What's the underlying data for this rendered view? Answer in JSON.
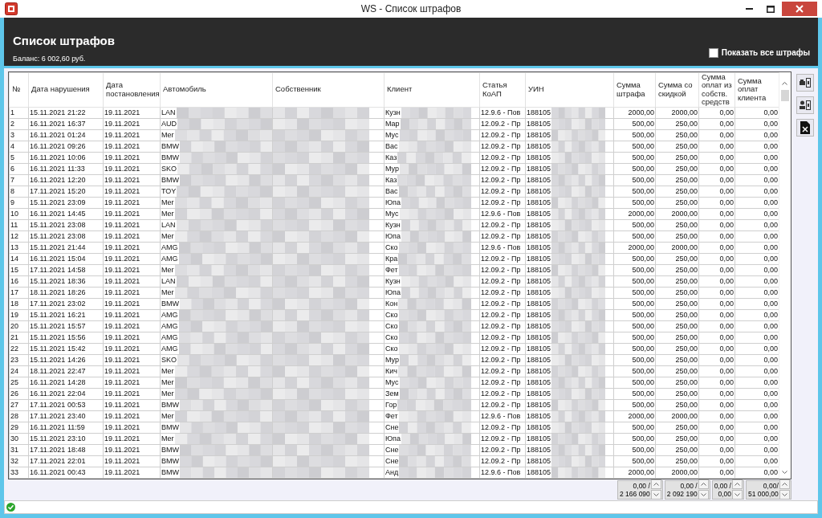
{
  "window": {
    "title": "WS - Список штрафов"
  },
  "header": {
    "title": "Список штрафов",
    "balance": "Баланс: 6 002,60 руб.",
    "show_all": {
      "label": "Показать все штрафы",
      "checked": false
    }
  },
  "table": {
    "columns": [
      "№",
      "Дата нарушения",
      "Дата постановления",
      "Автомобиль",
      "Собственник",
      "Клиент",
      "Статья КоАП",
      "УИН",
      "Сумма штрафа",
      "Сумма со скидкой",
      "Сумма оплат из собств. средств",
      "Сумма оплат клиента"
    ],
    "rows": [
      {
        "no": "1",
        "violation_date": "15.11.2021 21:22",
        "ruling_date": "19.11.2021",
        "car": "LAN",
        "client": "Кузн",
        "article": "12.9.6 - Пов",
        "uin": "188105",
        "fine": "2000,00",
        "discounted": "2000,00",
        "own_paid": "0,00",
        "client_paid": "0,00"
      },
      {
        "no": "2",
        "violation_date": "16.11.2021 16:37",
        "ruling_date": "19.11.2021",
        "car": "AUD",
        "client": "Мар",
        "article": "12.09.2 - Пр",
        "uin": "188105",
        "fine": "500,00",
        "discounted": "250,00",
        "own_paid": "0,00",
        "client_paid": "0,00"
      },
      {
        "no": "3",
        "violation_date": "16.11.2021 01:24",
        "ruling_date": "19.11.2021",
        "car": "Mer",
        "client": "Мус",
        "article": "12.09.2 - Пр",
        "uin": "188105",
        "fine": "500,00",
        "discounted": "250,00",
        "own_paid": "0,00",
        "client_paid": "0,00"
      },
      {
        "no": "4",
        "violation_date": "16.11.2021 09:26",
        "ruling_date": "19.11.2021",
        "car": "BMW",
        "client": "Вас",
        "article": "12.09.2 - Пр",
        "uin": "188105",
        "fine": "500,00",
        "discounted": "250,00",
        "own_paid": "0,00",
        "client_paid": "0,00"
      },
      {
        "no": "5",
        "violation_date": "16.11.2021 10:06",
        "ruling_date": "19.11.2021",
        "car": "BMW",
        "client": "Каз",
        "article": "12.09.2 - Пр",
        "uin": "188105",
        "fine": "500,00",
        "discounted": "250,00",
        "own_paid": "0,00",
        "client_paid": "0,00"
      },
      {
        "no": "6",
        "violation_date": "16.11.2021 11:33",
        "ruling_date": "19.11.2021",
        "car": "SKO",
        "client": "Мур",
        "article": "12.09.2 - Пр",
        "uin": "188105",
        "fine": "500,00",
        "discounted": "250,00",
        "own_paid": "0,00",
        "client_paid": "0,00"
      },
      {
        "no": "7",
        "violation_date": "16.11.2021 12:20",
        "ruling_date": "19.11.2021",
        "car": "BMW",
        "client": "Каз",
        "article": "12.09.2 - Пр",
        "uin": "188105",
        "fine": "500,00",
        "discounted": "250,00",
        "own_paid": "0,00",
        "client_paid": "0,00"
      },
      {
        "no": "8",
        "violation_date": "17.11.2021 15:20",
        "ruling_date": "19.11.2021",
        "car": "TOY",
        "client": "Вас",
        "article": "12.09.2 - Пр",
        "uin": "188105",
        "fine": "500,00",
        "discounted": "250,00",
        "own_paid": "0,00",
        "client_paid": "0,00"
      },
      {
        "no": "9",
        "violation_date": "15.11.2021 23:09",
        "ruling_date": "19.11.2021",
        "car": "Mer",
        "client": "Юпа",
        "article": "12.09.2 - Пр",
        "uin": "188105",
        "fine": "500,00",
        "discounted": "250,00",
        "own_paid": "0,00",
        "client_paid": "0,00"
      },
      {
        "no": "10",
        "violation_date": "16.11.2021 14:45",
        "ruling_date": "19.11.2021",
        "car": "Mer",
        "client": "Мус",
        "article": "12.9.6 - Пов",
        "uin": "188105",
        "fine": "2000,00",
        "discounted": "2000,00",
        "own_paid": "0,00",
        "client_paid": "0,00"
      },
      {
        "no": "11",
        "violation_date": "15.11.2021 23:08",
        "ruling_date": "19.11.2021",
        "car": "LAN",
        "client": "Кузн",
        "article": "12.09.2 - Пр",
        "uin": "188105",
        "fine": "500,00",
        "discounted": "250,00",
        "own_paid": "0,00",
        "client_paid": "0,00"
      },
      {
        "no": "12",
        "violation_date": "15.11.2021 23:08",
        "ruling_date": "19.11.2021",
        "car": "Mer",
        "client": "Юпа",
        "article": "12.09.2 - Пр",
        "uin": "188105",
        "fine": "500,00",
        "discounted": "250,00",
        "own_paid": "0,00",
        "client_paid": "0,00"
      },
      {
        "no": "13",
        "violation_date": "15.11.2021 21:44",
        "ruling_date": "19.11.2021",
        "car": "AMG",
        "client": "Ско",
        "article": "12.9.6 - Пов",
        "uin": "188105",
        "fine": "2000,00",
        "discounted": "2000,00",
        "own_paid": "0,00",
        "client_paid": "0,00"
      },
      {
        "no": "14",
        "violation_date": "16.11.2021 15:04",
        "ruling_date": "19.11.2021",
        "car": "AMG",
        "client": "Кра",
        "article": "12.09.2 - Пр",
        "uin": "188105",
        "fine": "500,00",
        "discounted": "250,00",
        "own_paid": "0,00",
        "client_paid": "0,00"
      },
      {
        "no": "15",
        "violation_date": "17.11.2021 14:58",
        "ruling_date": "19.11.2021",
        "car": "Mer",
        "client": "Фет",
        "article": "12.09.2 - Пр",
        "uin": "188105",
        "fine": "500,00",
        "discounted": "250,00",
        "own_paid": "0,00",
        "client_paid": "0,00"
      },
      {
        "no": "16",
        "violation_date": "15.11.2021 18:36",
        "ruling_date": "19.11.2021",
        "car": "LAN",
        "client": "Кузн",
        "article": "12.09.2 - Пр",
        "uin": "188105",
        "fine": "500,00",
        "discounted": "250,00",
        "own_paid": "0,00",
        "client_paid": "0,00"
      },
      {
        "no": "17",
        "violation_date": "18.11.2021 18:26",
        "ruling_date": "19.11.2021",
        "car": "Mer",
        "client": "Юпа",
        "article": "12.09.2 - Пр",
        "uin": "188105",
        "fine": "500,00",
        "discounted": "250,00",
        "own_paid": "0,00",
        "client_paid": "0,00"
      },
      {
        "no": "18",
        "violation_date": "17.11.2021 23:02",
        "ruling_date": "19.11.2021",
        "car": "BMW",
        "client": "Кон",
        "article": "12.09.2 - Пр",
        "uin": "188105",
        "fine": "500,00",
        "discounted": "250,00",
        "own_paid": "0,00",
        "client_paid": "0,00"
      },
      {
        "no": "19",
        "violation_date": "15.11.2021 16:21",
        "ruling_date": "19.11.2021",
        "car": "AMG",
        "client": "Ско",
        "article": "12.09.2 - Пр",
        "uin": "188105",
        "fine": "500,00",
        "discounted": "250,00",
        "own_paid": "0,00",
        "client_paid": "0,00"
      },
      {
        "no": "20",
        "violation_date": "15.11.2021 15:57",
        "ruling_date": "19.11.2021",
        "car": "AMG",
        "client": "Ско",
        "article": "12.09.2 - Пр",
        "uin": "188105",
        "fine": "500,00",
        "discounted": "250,00",
        "own_paid": "0,00",
        "client_paid": "0,00"
      },
      {
        "no": "21",
        "violation_date": "15.11.2021 15:56",
        "ruling_date": "19.11.2021",
        "car": "AMG",
        "client": "Ско",
        "article": "12.09.2 - Пр",
        "uin": "188105",
        "fine": "500,00",
        "discounted": "250,00",
        "own_paid": "0,00",
        "client_paid": "0,00"
      },
      {
        "no": "22",
        "violation_date": "15.11.2021 15:42",
        "ruling_date": "19.11.2021",
        "car": "AMG",
        "client": "Ско",
        "article": "12.09.2 - Пр",
        "uin": "188105",
        "fine": "500,00",
        "discounted": "250,00",
        "own_paid": "0,00",
        "client_paid": "0,00"
      },
      {
        "no": "23",
        "violation_date": "15.11.2021 14:26",
        "ruling_date": "19.11.2021",
        "car": "SKO",
        "client": "Мур",
        "article": "12.09.2 - Пр",
        "uin": "188105",
        "fine": "500,00",
        "discounted": "250,00",
        "own_paid": "0,00",
        "client_paid": "0,00"
      },
      {
        "no": "24",
        "violation_date": "18.11.2021 22:47",
        "ruling_date": "19.11.2021",
        "car": "Mer",
        "client": "Кич",
        "article": "12.09.2 - Пр",
        "uin": "188105",
        "fine": "500,00",
        "discounted": "250,00",
        "own_paid": "0,00",
        "client_paid": "0,00"
      },
      {
        "no": "25",
        "violation_date": "16.11.2021 14:28",
        "ruling_date": "19.11.2021",
        "car": "Mer",
        "client": "Мус",
        "article": "12.09.2 - Пр",
        "uin": "188105",
        "fine": "500,00",
        "discounted": "250,00",
        "own_paid": "0,00",
        "client_paid": "0,00"
      },
      {
        "no": "26",
        "violation_date": "16.11.2021 22:04",
        "ruling_date": "19.11.2021",
        "car": "Mer",
        "client": "Зем",
        "article": "12.09.2 - Пр",
        "uin": "188105",
        "fine": "500,00",
        "discounted": "250,00",
        "own_paid": "0,00",
        "client_paid": "0,00"
      },
      {
        "no": "27",
        "violation_date": "17.11.2021 00:53",
        "ruling_date": "19.11.2021",
        "car": "BMW",
        "client": "Гор",
        "article": "12.09.2 - Пр",
        "uin": "188105",
        "fine": "500,00",
        "discounted": "250,00",
        "own_paid": "0,00",
        "client_paid": "0,00"
      },
      {
        "no": "28",
        "violation_date": "17.11.2021 23:40",
        "ruling_date": "19.11.2021",
        "car": "Mer",
        "client": "Фет",
        "article": "12.9.6 - Пов",
        "uin": "188105",
        "fine": "2000,00",
        "discounted": "2000,00",
        "own_paid": "0,00",
        "client_paid": "0,00"
      },
      {
        "no": "29",
        "violation_date": "16.11.2021 11:59",
        "ruling_date": "19.11.2021",
        "car": "BMW",
        "client": "Сне",
        "article": "12.09.2 - Пр",
        "uin": "188105",
        "fine": "500,00",
        "discounted": "250,00",
        "own_paid": "0,00",
        "client_paid": "0,00"
      },
      {
        "no": "30",
        "violation_date": "15.11.2021 23:10",
        "ruling_date": "19.11.2021",
        "car": "Mer",
        "client": "Юпа",
        "article": "12.09.2 - Пр",
        "uin": "188105",
        "fine": "500,00",
        "discounted": "250,00",
        "own_paid": "0,00",
        "client_paid": "0,00"
      },
      {
        "no": "31",
        "violation_date": "17.11.2021 18:48",
        "ruling_date": "19.11.2021",
        "car": "BMW",
        "client": "Сне",
        "article": "12.09.2 - Пр",
        "uin": "188105",
        "fine": "500,00",
        "discounted": "250,00",
        "own_paid": "0,00",
        "client_paid": "0,00"
      },
      {
        "no": "32",
        "violation_date": "17.11.2021 22:01",
        "ruling_date": "19.11.2021",
        "car": "BMW",
        "client": "Сне",
        "article": "12.09.2 - Пр",
        "uin": "188105",
        "fine": "500,00",
        "discounted": "250,00",
        "own_paid": "0,00",
        "client_paid": "0,00"
      },
      {
        "no": "33",
        "violation_date": "16.11.2021 00:43",
        "ruling_date": "19.11.2021",
        "car": "BMW",
        "client": "Анд",
        "article": "12.9.6 - Пов",
        "uin": "188105",
        "fine": "2000,00",
        "discounted": "2000,00",
        "own_paid": "0,00",
        "client_paid": "0,00"
      }
    ]
  },
  "totals": [
    {
      "paid": "0,00 /",
      "total": "2 166 090"
    },
    {
      "paid": "0,00 /",
      "total": "2 092 190"
    },
    {
      "paid": "0,00 /",
      "total": "0,00"
    },
    {
      "paid": "0,00/",
      "total": "51 000,00"
    }
  ]
}
